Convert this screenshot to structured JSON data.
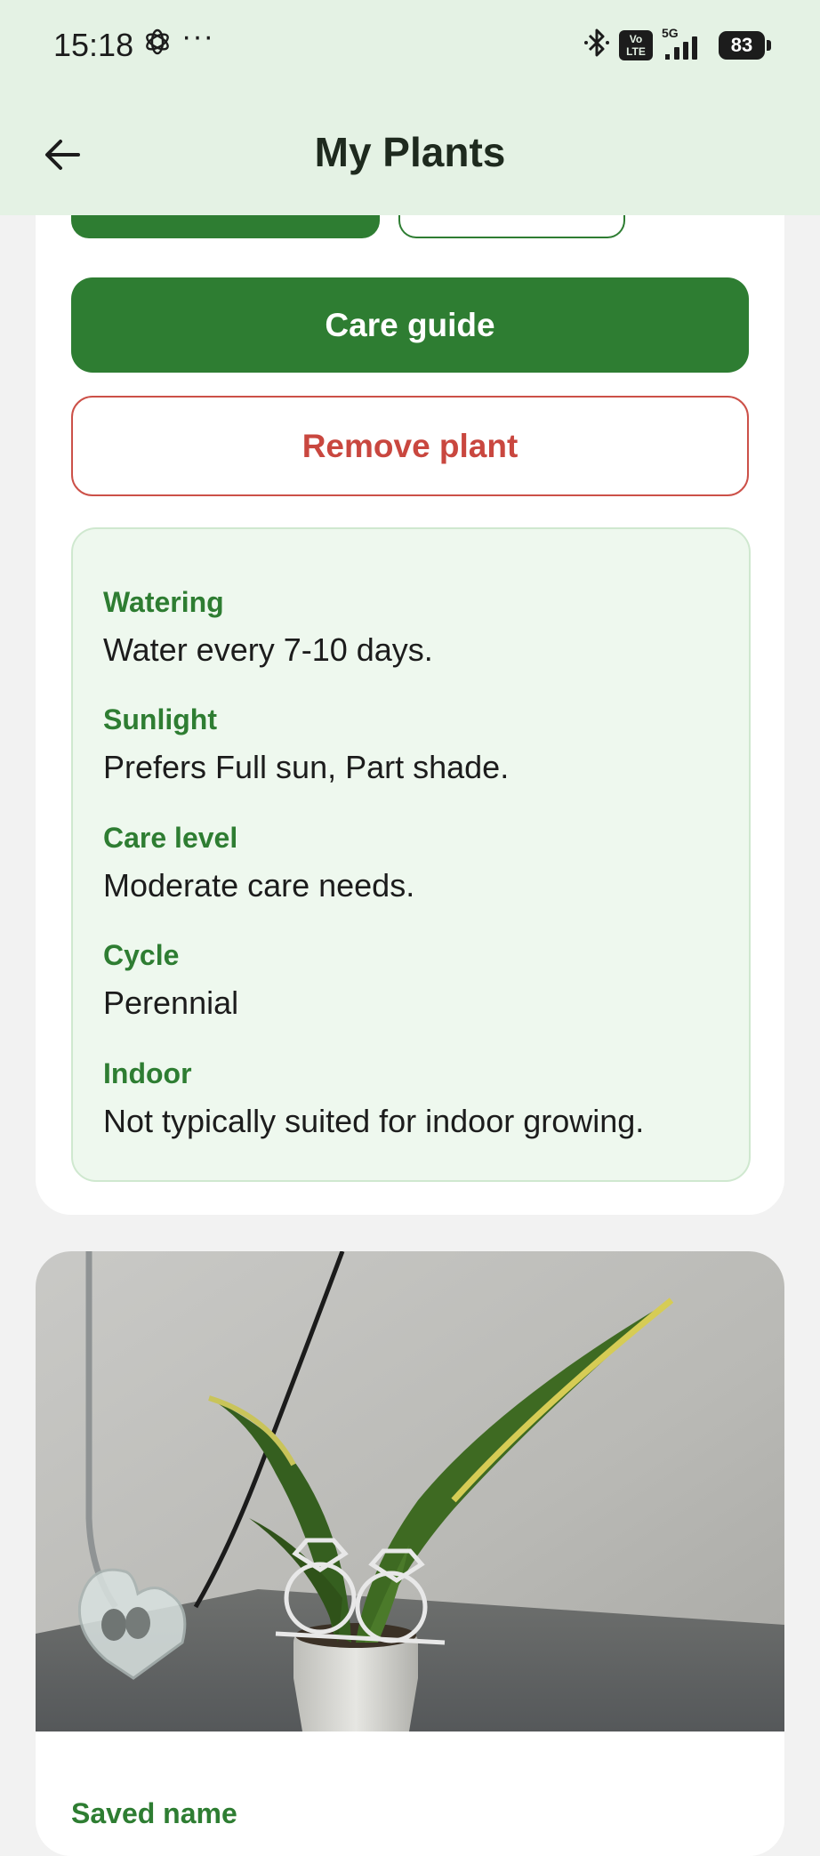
{
  "status_bar": {
    "time": "15:18",
    "more": "···",
    "network": "5G",
    "volte": "Vo LTE",
    "battery": "83"
  },
  "app_bar": {
    "title": "My Plants",
    "back_icon": "arrow-left-icon"
  },
  "actions": {
    "care_guide": "Care guide",
    "remove_plant": "Remove plant"
  },
  "care_info": [
    {
      "label": "Watering",
      "value": "Water every 7-10 days."
    },
    {
      "label": "Sunlight",
      "value": "Prefers Full sun, Part shade."
    },
    {
      "label": "Care level",
      "value": "Moderate care needs."
    },
    {
      "label": "Cycle",
      "value": "Perennial"
    },
    {
      "label": "Indoor",
      "value": "Not typically suited for indoor growing."
    }
  ],
  "next_plant": {
    "saved_name_label": "Saved name"
  },
  "colors": {
    "primary_green": "#2e7d32",
    "danger_red": "#c9473f",
    "header_bg": "#e4f2e4",
    "panel_bg": "#eef8ee"
  }
}
